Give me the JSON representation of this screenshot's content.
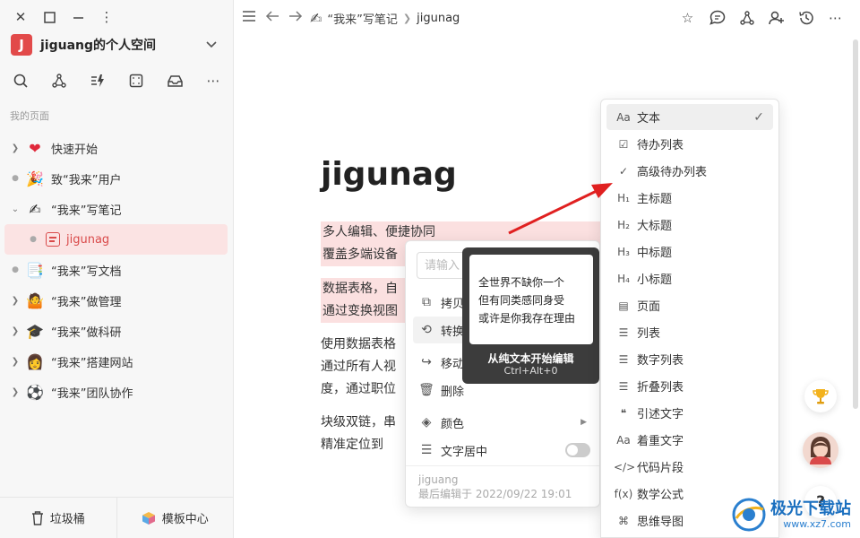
{
  "window": {
    "breadcrumb": [
      "“我来”写笔记",
      "jigunag"
    ]
  },
  "sidebar": {
    "space_avatar": "J",
    "space_name": "jiguang的个人空间",
    "section_label": "我的页面",
    "items": [
      {
        "label": "快速开始",
        "emoji": "❤️",
        "expandable": true
      },
      {
        "label": "致“我来”用户",
        "emoji": "🎉",
        "expandable": false
      },
      {
        "label": "“我来”写笔记",
        "emoji": "✍🏻",
        "expandable": true,
        "expanded": true
      },
      {
        "label": "jigunag",
        "child": true,
        "active": true
      },
      {
        "label": "“我来”写文档",
        "emoji": "📑",
        "expandable": false
      },
      {
        "label": "“我来”做管理",
        "emoji": "🤷",
        "expandable": true
      },
      {
        "label": "“我来”做科研",
        "emoji": "🎓",
        "expandable": true
      },
      {
        "label": "“我来”搭建网站",
        "emoji": "👩🏻‍💻",
        "expandable": true
      },
      {
        "label": "“我来”团队协作",
        "emoji": "⚽",
        "expandable": true
      }
    ],
    "trash_label": "垃圾桶",
    "templates_label": "模板中心"
  },
  "editor": {
    "title": "jigunag",
    "para1_line1": "多人编辑、便捷协同",
    "para1_line2": "覆盖多端设备",
    "para2_line1": "数据表格，自",
    "para2_line2": "通过变换视图",
    "para3_line1": "使用数据表格",
    "para3_line2": "通过所有人视",
    "para3_line3": "度，通过职位",
    "para4_line1": "块级双链，串",
    "para4_line2": "精准定位到"
  },
  "context_menu": {
    "search_placeholder": "请输入",
    "copy": "拷贝",
    "convert": "转换",
    "move": "移动/嵌入",
    "delete": "删除",
    "color": "颜色",
    "center_text": "文字居中",
    "author": "jiguang",
    "last_edited": "最后编辑于 2022/09/22 19:01"
  },
  "tooltip": {
    "line1": "全世界不缺你一个",
    "line2": "但有同类感同身受",
    "line3": "或许是你我存在理由",
    "title": "从纯文本开始编辑",
    "shortcut": "Ctrl+Alt+0"
  },
  "block_types": [
    {
      "icon": "Aa",
      "label": "文本",
      "selected": true
    },
    {
      "icon": "☑",
      "label": "待办列表"
    },
    {
      "icon": "✓",
      "label": "高级待办列表"
    },
    {
      "icon": "H₁",
      "label": "主标题"
    },
    {
      "icon": "H₂",
      "label": "大标题"
    },
    {
      "icon": "H₃",
      "label": "中标题"
    },
    {
      "icon": "H₄",
      "label": "小标题"
    },
    {
      "icon": "▤",
      "label": "页面"
    },
    {
      "icon": "☰",
      "label": "列表"
    },
    {
      "icon": "☰",
      "label": "数字列表"
    },
    {
      "icon": "☰",
      "label": "折叠列表"
    },
    {
      "icon": "❝",
      "label": "引述文字"
    },
    {
      "icon": "Aa",
      "label": "着重文字"
    },
    {
      "icon": "</>",
      "label": "代码片段"
    },
    {
      "icon": "f(x)",
      "label": "数学公式"
    },
    {
      "icon": "⌘",
      "label": "思维导图"
    }
  ],
  "watermark": {
    "brand": "极光下载站",
    "url": "www.xz7.com"
  },
  "colors": {
    "accent": "#d94a4a",
    "highlight": "#fbe0e0",
    "arrow": "#e02020"
  }
}
